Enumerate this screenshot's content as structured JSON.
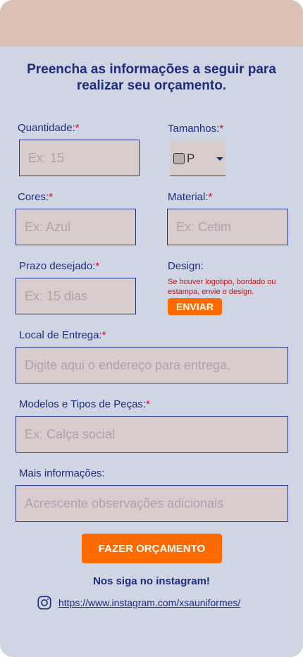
{
  "form": {
    "heading": "Preencha as informações a seguir para realizar seu orçamento.",
    "required_mark": "*",
    "quantidade": {
      "label": "Quantidade:",
      "placeholder": "Ex: 15"
    },
    "tamanhos": {
      "label": "Tamanhos:",
      "selected": "P"
    },
    "cores": {
      "label": "Cores:",
      "placeholder": "Ex: Azul"
    },
    "material": {
      "label": "Material:",
      "placeholder": "Ex: Cetim"
    },
    "prazo": {
      "label": "Prazo desejado:",
      "placeholder": "Ex: 15 dias"
    },
    "design": {
      "label": "Design:",
      "note": "Se houver logotipo, bordado ou estampa, envie o design.",
      "button": "ENVIAR"
    },
    "local": {
      "label": "Local de Entrega:",
      "placeholder": "Digite aqui o endereço para entrega."
    },
    "modelos": {
      "label": "Modelos e Tipos de Peças:",
      "placeholder": "Ex: Calça social"
    },
    "info": {
      "label": "Mais informações:",
      "placeholder": "Acrescente observações adicionais"
    },
    "submit": "FAZER ORÇAMENTO"
  },
  "footer": {
    "follow": "Nos siga no instagram!",
    "link": "https://www.instagram.com/xsauniformes/",
    "icon": "instagram-icon"
  },
  "colors": {
    "background": "#cfd5e3",
    "topbar": "#dcc1b6",
    "accent": "#ff6a00",
    "text": "#1d2d7d",
    "required": "#c4121a",
    "field": "#d9cccd"
  }
}
